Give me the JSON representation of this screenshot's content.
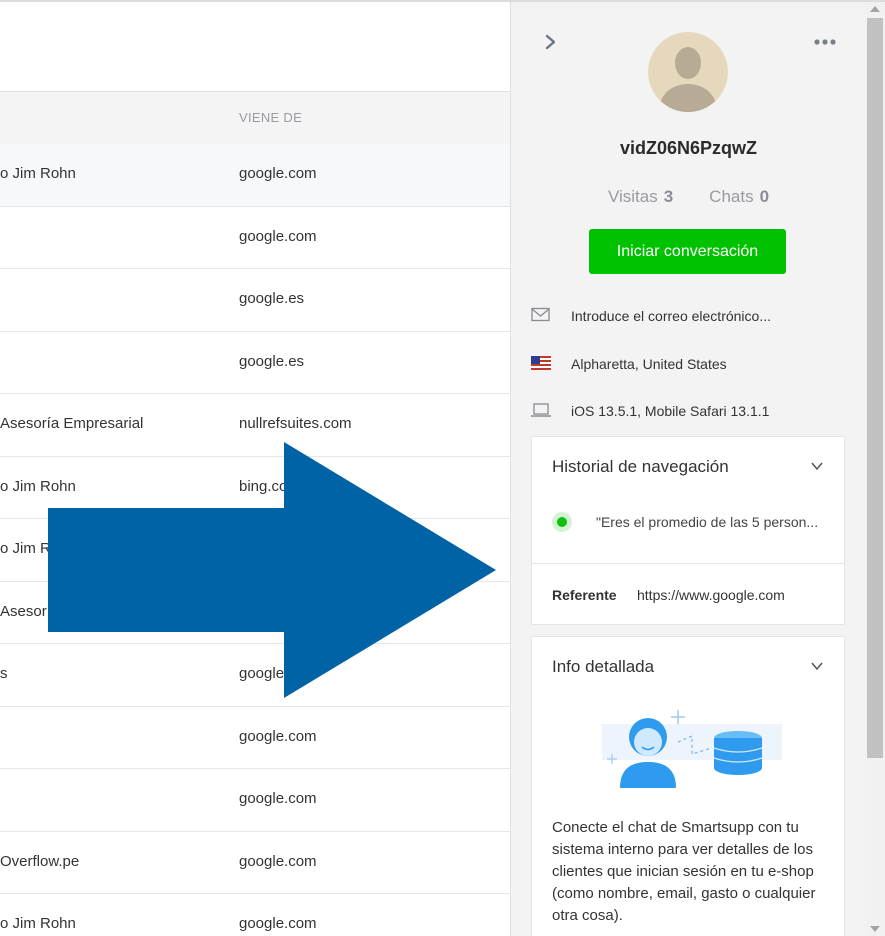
{
  "table": {
    "column_header": "VIENE DE",
    "rows": [
      {
        "c1": "o Jim Rohn",
        "c2": "google.com"
      },
      {
        "c1": "",
        "c2": "google.com"
      },
      {
        "c1": "",
        "c2": "google.es"
      },
      {
        "c1": "",
        "c2": "google.es"
      },
      {
        "c1": "Asesoría Empresarial",
        "c2": "nullrefsuites.com"
      },
      {
        "c1": "o Jim Rohn",
        "c2": "bing.com"
      },
      {
        "c1": "o Jim Rohn",
        "c2": ""
      },
      {
        "c1": "Asesoría Empresarial",
        "c2": ""
      },
      {
        "c1": "s",
        "c2": "google.com"
      },
      {
        "c1": "",
        "c2": "google.com"
      },
      {
        "c1": "",
        "c2": "google.com"
      },
      {
        "c1": "Overflow.pe",
        "c2": "google.com"
      },
      {
        "c1": "o Jim Rohn",
        "c2": "google.com"
      }
    ]
  },
  "overlay": {
    "arrow_color": "#0063a6",
    "arrow_icon": "arrow-right-icon"
  },
  "panel": {
    "visitor_name": "vidZ06N6PzqwZ",
    "visits_label": "Visitas",
    "visits_value": "3",
    "chats_label": "Chats",
    "chats_value": "0",
    "start_button": "Iniciar conversación",
    "start_button_color": "#00c200",
    "email_placeholder": "Introduce el correo electrónico...",
    "location": "Alpharetta, United States",
    "device": "iOS 13.5.1, Mobile Safari 13.1.1",
    "history": {
      "title": "Historial de navegación",
      "item": "\"Eres el promedio de las 5 person...",
      "referrer_label": "Referente",
      "referrer_value": "https://www.google.com"
    },
    "detail": {
      "title": "Info detallada",
      "description": "Conecte el chat de Smartsupp con tu sistema interno para ver detalles de los clientes que inician sesión en tu e-shop (como nombre, email, gasto o cualquier otra cosa)."
    }
  }
}
